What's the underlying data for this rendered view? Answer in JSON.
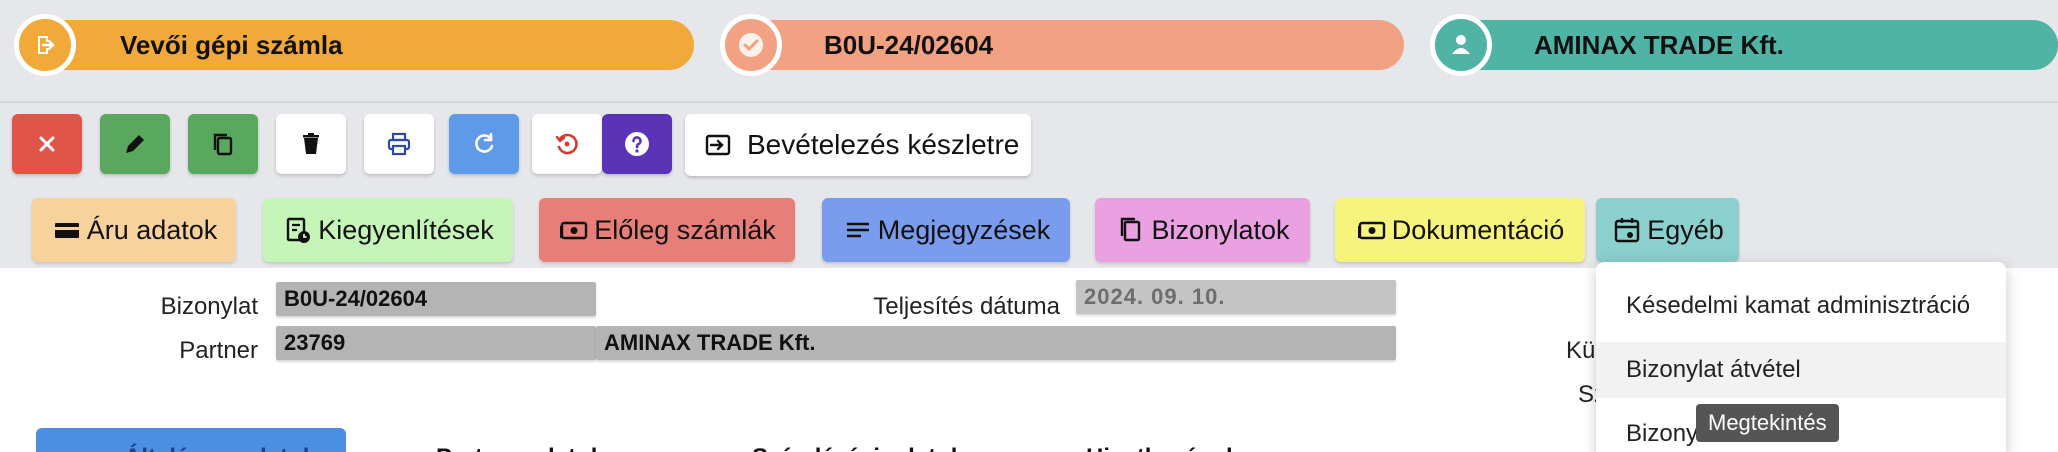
{
  "header": {
    "doc_type": "Vevői gépi számla",
    "doc_number": "B0U-24/02604",
    "partner_name": "AMINAX TRADE Kft."
  },
  "toolbar": {
    "receive_stock_label": "Bevételezés készletre"
  },
  "tabs": [
    {
      "label": "Áru adatok"
    },
    {
      "label": "Kiegyenlítések"
    },
    {
      "label": "Előleg számlák"
    },
    {
      "label": "Megjegyzések"
    },
    {
      "label": "Bizonylatok"
    },
    {
      "label": "Dokumentáció"
    },
    {
      "label": "Egyéb"
    }
  ],
  "form": {
    "doc_label": "Bizonylat",
    "doc_value": "B0U-24/02604",
    "partner_label": "Partner",
    "partner_code": "23769",
    "partner_name": "AMINAX TRADE Kft.",
    "fulfillment_label": "Teljesítés dátuma",
    "fulfillment_value": "2024. 09. 10.",
    "cut_label_1": "Kü",
    "cut_label_2": "Sz"
  },
  "bottom_tabs": {
    "partial_1": "Általános adatok",
    "partial_2": "Partner adatok",
    "partial_3": "Számlázási adatok",
    "partial_4": "Hivatkozások"
  },
  "dropdown": {
    "items": [
      {
        "label": "Késedelmi kamat adminisztráció"
      },
      {
        "label": "Bizonylat átvétel"
      },
      {
        "label": "Bizony"
      }
    ]
  },
  "tooltip": "Megtekintés",
  "colors": {
    "doc_type_pill": "#f1a93a",
    "doc_number_pill": "#f2a283",
    "partner_pill": "#4fb3a5",
    "btn_close": "#e05547",
    "btn_edit": "#5aa85e",
    "btn_copy": "#5aa85e",
    "btn_refresh": "#5e9ae8",
    "btn_help": "#5b33b6"
  }
}
